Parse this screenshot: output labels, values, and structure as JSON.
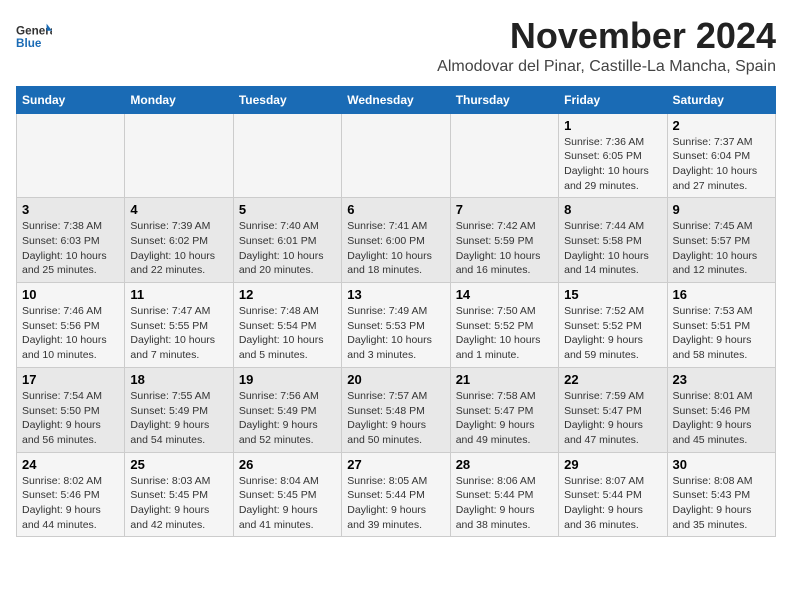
{
  "logo": {
    "line1": "General",
    "line2": "Blue"
  },
  "title": "November 2024",
  "location": "Almodovar del Pinar, Castille-La Mancha, Spain",
  "days_of_week": [
    "Sunday",
    "Monday",
    "Tuesday",
    "Wednesday",
    "Thursday",
    "Friday",
    "Saturday"
  ],
  "weeks": [
    [
      {
        "day": "",
        "info": ""
      },
      {
        "day": "",
        "info": ""
      },
      {
        "day": "",
        "info": ""
      },
      {
        "day": "",
        "info": ""
      },
      {
        "day": "",
        "info": ""
      },
      {
        "day": "1",
        "info": "Sunrise: 7:36 AM\nSunset: 6:05 PM\nDaylight: 10 hours\nand 29 minutes."
      },
      {
        "day": "2",
        "info": "Sunrise: 7:37 AM\nSunset: 6:04 PM\nDaylight: 10 hours\nand 27 minutes."
      }
    ],
    [
      {
        "day": "3",
        "info": "Sunrise: 7:38 AM\nSunset: 6:03 PM\nDaylight: 10 hours\nand 25 minutes."
      },
      {
        "day": "4",
        "info": "Sunrise: 7:39 AM\nSunset: 6:02 PM\nDaylight: 10 hours\nand 22 minutes."
      },
      {
        "day": "5",
        "info": "Sunrise: 7:40 AM\nSunset: 6:01 PM\nDaylight: 10 hours\nand 20 minutes."
      },
      {
        "day": "6",
        "info": "Sunrise: 7:41 AM\nSunset: 6:00 PM\nDaylight: 10 hours\nand 18 minutes."
      },
      {
        "day": "7",
        "info": "Sunrise: 7:42 AM\nSunset: 5:59 PM\nDaylight: 10 hours\nand 16 minutes."
      },
      {
        "day": "8",
        "info": "Sunrise: 7:44 AM\nSunset: 5:58 PM\nDaylight: 10 hours\nand 14 minutes."
      },
      {
        "day": "9",
        "info": "Sunrise: 7:45 AM\nSunset: 5:57 PM\nDaylight: 10 hours\nand 12 minutes."
      }
    ],
    [
      {
        "day": "10",
        "info": "Sunrise: 7:46 AM\nSunset: 5:56 PM\nDaylight: 10 hours\nand 10 minutes."
      },
      {
        "day": "11",
        "info": "Sunrise: 7:47 AM\nSunset: 5:55 PM\nDaylight: 10 hours\nand 7 minutes."
      },
      {
        "day": "12",
        "info": "Sunrise: 7:48 AM\nSunset: 5:54 PM\nDaylight: 10 hours\nand 5 minutes."
      },
      {
        "day": "13",
        "info": "Sunrise: 7:49 AM\nSunset: 5:53 PM\nDaylight: 10 hours\nand 3 minutes."
      },
      {
        "day": "14",
        "info": "Sunrise: 7:50 AM\nSunset: 5:52 PM\nDaylight: 10 hours\nand 1 minute."
      },
      {
        "day": "15",
        "info": "Sunrise: 7:52 AM\nSunset: 5:52 PM\nDaylight: 9 hours\nand 59 minutes."
      },
      {
        "day": "16",
        "info": "Sunrise: 7:53 AM\nSunset: 5:51 PM\nDaylight: 9 hours\nand 58 minutes."
      }
    ],
    [
      {
        "day": "17",
        "info": "Sunrise: 7:54 AM\nSunset: 5:50 PM\nDaylight: 9 hours\nand 56 minutes."
      },
      {
        "day": "18",
        "info": "Sunrise: 7:55 AM\nSunset: 5:49 PM\nDaylight: 9 hours\nand 54 minutes."
      },
      {
        "day": "19",
        "info": "Sunrise: 7:56 AM\nSunset: 5:49 PM\nDaylight: 9 hours\nand 52 minutes."
      },
      {
        "day": "20",
        "info": "Sunrise: 7:57 AM\nSunset: 5:48 PM\nDaylight: 9 hours\nand 50 minutes."
      },
      {
        "day": "21",
        "info": "Sunrise: 7:58 AM\nSunset: 5:47 PM\nDaylight: 9 hours\nand 49 minutes."
      },
      {
        "day": "22",
        "info": "Sunrise: 7:59 AM\nSunset: 5:47 PM\nDaylight: 9 hours\nand 47 minutes."
      },
      {
        "day": "23",
        "info": "Sunrise: 8:01 AM\nSunset: 5:46 PM\nDaylight: 9 hours\nand 45 minutes."
      }
    ],
    [
      {
        "day": "24",
        "info": "Sunrise: 8:02 AM\nSunset: 5:46 PM\nDaylight: 9 hours\nand 44 minutes."
      },
      {
        "day": "25",
        "info": "Sunrise: 8:03 AM\nSunset: 5:45 PM\nDaylight: 9 hours\nand 42 minutes."
      },
      {
        "day": "26",
        "info": "Sunrise: 8:04 AM\nSunset: 5:45 PM\nDaylight: 9 hours\nand 41 minutes."
      },
      {
        "day": "27",
        "info": "Sunrise: 8:05 AM\nSunset: 5:44 PM\nDaylight: 9 hours\nand 39 minutes."
      },
      {
        "day": "28",
        "info": "Sunrise: 8:06 AM\nSunset: 5:44 PM\nDaylight: 9 hours\nand 38 minutes."
      },
      {
        "day": "29",
        "info": "Sunrise: 8:07 AM\nSunset: 5:44 PM\nDaylight: 9 hours\nand 36 minutes."
      },
      {
        "day": "30",
        "info": "Sunrise: 8:08 AM\nSunset: 5:43 PM\nDaylight: 9 hours\nand 35 minutes."
      }
    ]
  ]
}
